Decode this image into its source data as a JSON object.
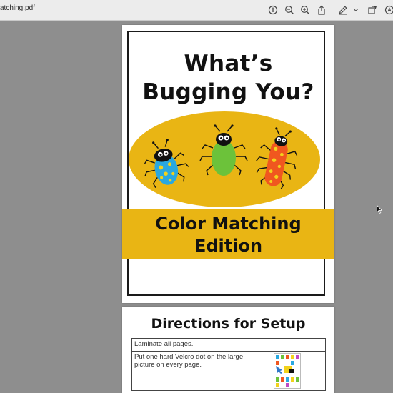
{
  "window": {
    "doc_title": "atching.pdf"
  },
  "toolbar": {
    "icons": [
      "info-icon",
      "zoom-out-icon",
      "zoom-in-icon",
      "share-icon",
      "markup-pen-icon",
      "chevron-down-icon",
      "rotate-icon",
      "search-icon"
    ]
  },
  "cover": {
    "title_line1": "What’s",
    "title_line2": "Bugging You?",
    "subtitle_line1": "Color Matching",
    "subtitle_line2": "Edition",
    "colors": {
      "banner": "#e9b514",
      "oval": "#e9b514",
      "blue_bug": "#29a8e0",
      "green_bug": "#6cc23a",
      "orange_bug": "#f0571f"
    }
  },
  "directions": {
    "title": "Directions for Setup",
    "rows": [
      {
        "text": "Laminate all pages.",
        "has_image": false
      },
      {
        "text": "Put one hard Velcro dot on the large picture on every page.",
        "has_image": true
      }
    ]
  }
}
